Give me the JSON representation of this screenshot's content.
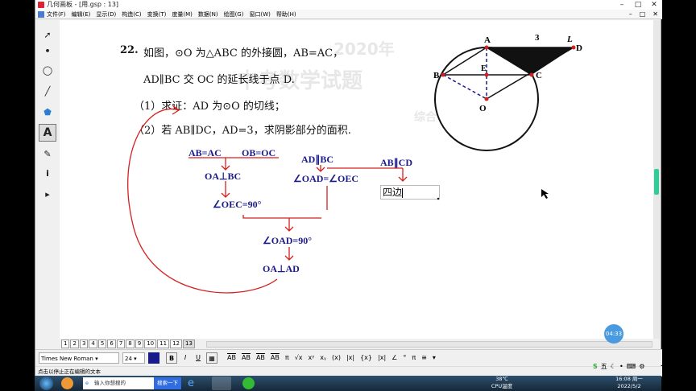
{
  "window": {
    "title": "几何画板 - [用.gsp : 13]",
    "controls": [
      "–",
      "□",
      "✕"
    ],
    "mdi_controls": [
      "–",
      "□",
      "✕"
    ]
  },
  "menu": [
    "文件(F)",
    "编辑(E)",
    "显示(D)",
    "构造(C)",
    "变换(T)",
    "度量(M)",
    "数据(N)",
    "绘图(G)",
    "窗口(W)",
    "帮助(H)"
  ],
  "tools": [
    {
      "name": "select-arrow-icon",
      "glyph": "➚"
    },
    {
      "name": "point-icon",
      "glyph": "•"
    },
    {
      "name": "compass-icon",
      "glyph": "◯"
    },
    {
      "name": "line-icon",
      "glyph": "╱"
    },
    {
      "name": "polygon-icon",
      "glyph": "⬟"
    },
    {
      "name": "text-icon",
      "glyph": "A"
    },
    {
      "name": "marker-icon",
      "glyph": "✎"
    },
    {
      "name": "info-icon",
      "glyph": "i"
    },
    {
      "name": "custom-tool-icon",
      "glyph": "▸"
    }
  ],
  "problem": {
    "number": "22.",
    "line1": "如图，⊙O 为△ABC 的外接圆，AB=AC，",
    "line2": "AD∥BC 交 OC 的延长线于点 D.",
    "part1": "（1）求证：AD 为⊙O 的切线；",
    "part2": "（2）若 AB∥DC，AD=3，求阴影部分的面积.",
    "figure_labels": {
      "A": "A",
      "B": "B",
      "C": "C",
      "D": "D",
      "E": "E",
      "O": "O",
      "L": "L",
      "len": "3"
    }
  },
  "handwriting": {
    "n1": "AB=AC",
    "n2": "OB=OC",
    "n3": "OA⊥BC",
    "n4": "∠OEC=90°",
    "n5": "AD∥BC",
    "n6": "∠OAD=∠OEC",
    "n7": "AB∥CD",
    "n8": "∠OAD=90°",
    "n9": "OA⊥AD"
  },
  "text_input": {
    "value": "四边"
  },
  "ghost_text": [
    "2020年",
    "中考数学试题",
    "综合"
  ],
  "page_tabs": [
    "1",
    "2",
    "3",
    "4",
    "5",
    "6",
    "7",
    "8",
    "9",
    "10",
    "11",
    "12",
    "13"
  ],
  "current_page": "13",
  "timer": "04:33",
  "text_toolbar": {
    "font": "Times New Roman",
    "size": "24",
    "bold": "B",
    "italic": "I",
    "underline": "U",
    "symbols": [
      "AB",
      "AB",
      "AB",
      "AB",
      "π",
      "√x",
      "xʸ",
      "xᵧ",
      "(x)",
      "|x|",
      "{x}",
      "|x|",
      "∠",
      "°",
      "π",
      "≅",
      "▾"
    ]
  },
  "status_text": "点击以停止正在编辑的文本",
  "taskbar": {
    "search_placeholder": "输入你想搜的",
    "search_button": "搜索一下",
    "cpu_temp": "38℃",
    "cpu_label": "CPU温度",
    "time": "16:08 周一",
    "date": "2022/5/2"
  },
  "colors": {
    "handwriting": "#1a1a8a",
    "annotation": "#d42020",
    "accent": "#3c9"
  }
}
